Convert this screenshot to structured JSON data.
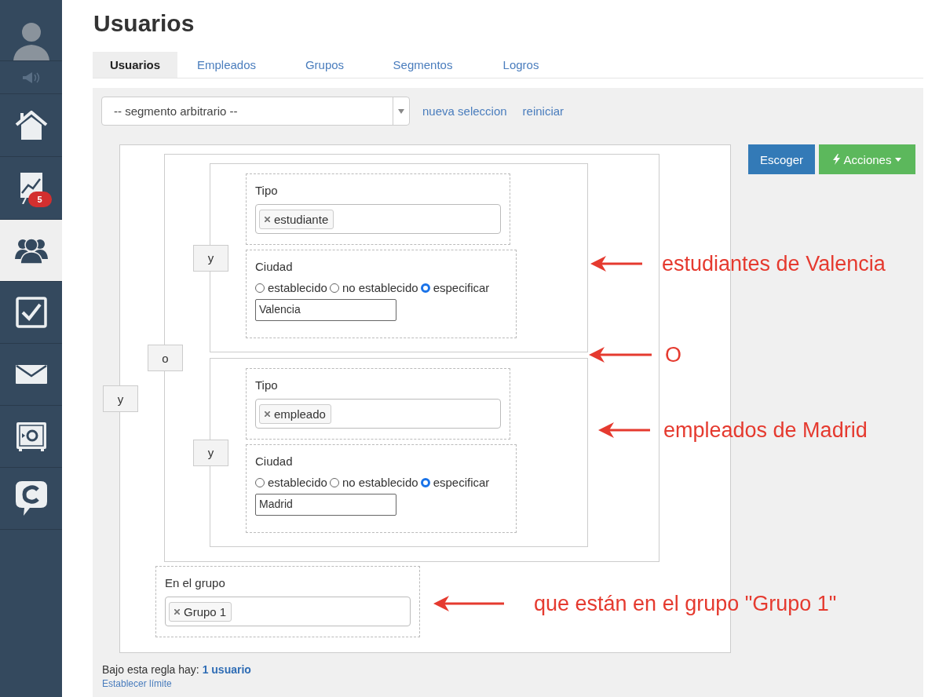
{
  "sidebar": {
    "items": [
      {
        "kind": "avatar",
        "selected": false
      },
      {
        "kind": "speaker",
        "selected": false
      },
      {
        "kind": "home",
        "selected": false
      },
      {
        "kind": "chart",
        "selected": false,
        "badge": "5"
      },
      {
        "kind": "users",
        "selected": true
      },
      {
        "kind": "check",
        "selected": false
      },
      {
        "kind": "mail",
        "selected": false
      },
      {
        "kind": "safe",
        "selected": false
      },
      {
        "kind": "chat",
        "selected": false
      }
    ]
  },
  "title": "Usuarios",
  "tabs": [
    {
      "label": "Usuarios",
      "selected": true
    },
    {
      "label": "Empleados",
      "selected": false
    },
    {
      "label": "Grupos",
      "selected": false
    },
    {
      "label": "Segmentos",
      "selected": false
    },
    {
      "label": "Logros",
      "selected": false
    }
  ],
  "segment_select": {
    "value": "-- segmento arbitrario --"
  },
  "links": [
    "nueva seleccion",
    "reiniciar"
  ],
  "buttons": {
    "choose": "Escoger",
    "actions": "Acciones"
  },
  "rule": {
    "operator": "y",
    "children": [
      {
        "kind": "group",
        "operator": "o",
        "children": [
          {
            "kind": "group",
            "operator": "y",
            "children": [
              {
                "kind": "tags",
                "label": "Tipo",
                "tags": [
                  "estudiante"
                ]
              },
              {
                "kind": "radio",
                "label": "Ciudad",
                "options": [
                  {
                    "label": "establecido",
                    "selected": false
                  },
                  {
                    "label": "no establecido",
                    "selected": false
                  },
                  {
                    "label": "especificar",
                    "selected": true
                  }
                ],
                "value": "Valencia"
              }
            ]
          },
          {
            "kind": "group",
            "operator": "y",
            "children": [
              {
                "kind": "tags",
                "label": "Tipo",
                "tags": [
                  "empleado"
                ]
              },
              {
                "kind": "radio",
                "label": "Ciudad",
                "options": [
                  {
                    "label": "establecido",
                    "selected": false
                  },
                  {
                    "label": "no establecido",
                    "selected": false
                  },
                  {
                    "label": "especificar",
                    "selected": true
                  }
                ],
                "value": "Madrid"
              }
            ]
          }
        ]
      },
      {
        "kind": "tags",
        "label": "En el grupo",
        "tags": [
          "Grupo 1"
        ]
      }
    ]
  },
  "annotations": [
    "estudiantes de Valencia",
    "O",
    "empleados de Madrid",
    "que están en el grupo \"Grupo 1\""
  ],
  "summary": {
    "text": "Bajo esta regla hay:",
    "count": "1 usuario"
  },
  "limit_link": "Establecer límite"
}
